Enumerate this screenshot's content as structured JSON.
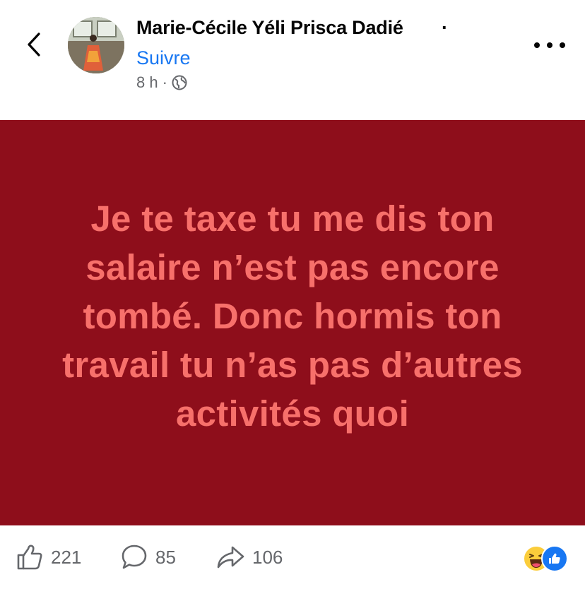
{
  "header": {
    "back_icon": "chevron-left-icon",
    "author_name": "Marie-Cécile Yéli Prisca Dadié",
    "name_separator": "·",
    "follow_label": "Suivre",
    "timestamp": "8 h",
    "meta_separator": "·",
    "audience_icon": "globe-icon",
    "more_icon": "more-dots-icon"
  },
  "post": {
    "background_color": "#8e0e1b",
    "text_color": "#f7706b",
    "text": "Je te taxe tu me dis ton salaire n’est pas encore tombé. Donc hormis ton travail tu n’as pas d’autres activités quoi"
  },
  "footer": {
    "likes_count": "221",
    "comments_count": "85",
    "shares_count": "106",
    "reaction_icons": [
      "haha-icon",
      "like-icon"
    ]
  },
  "colors": {
    "accent": "#1877f2",
    "secondary_text": "#65676b"
  }
}
